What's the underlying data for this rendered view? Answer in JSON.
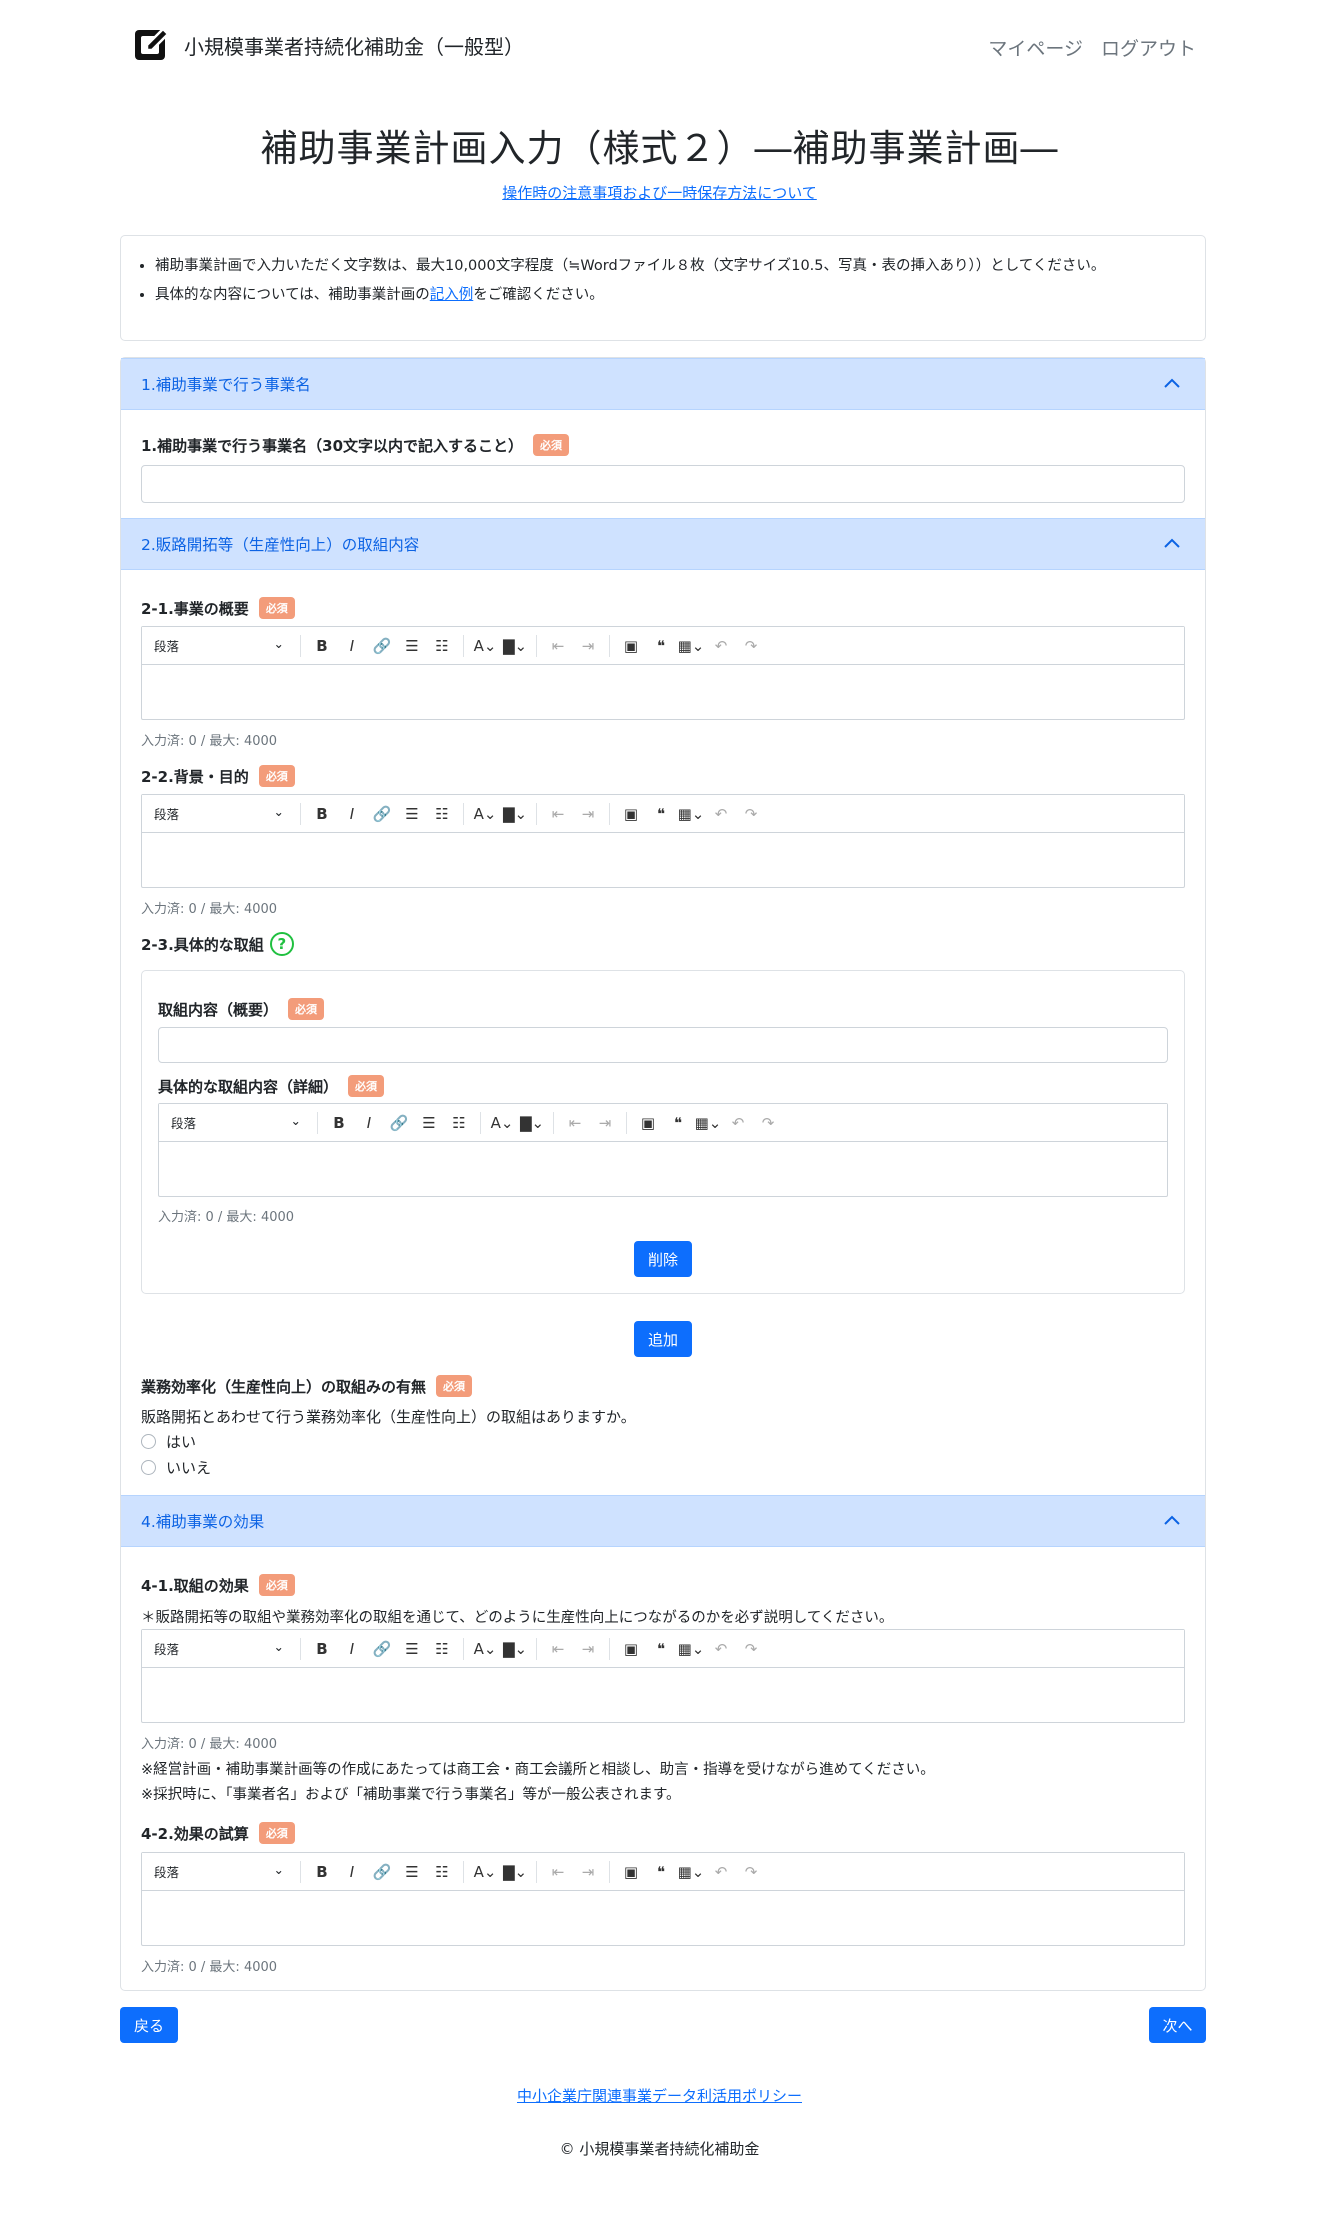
{
  "header": {
    "title": "小規模事業者持続化補助金（一般型）",
    "nav": [
      "マイページ",
      "ログアウト"
    ]
  },
  "page": {
    "title": "補助事業計画入力（様式２）―補助事業計画―",
    "notice_link": "操作時の注意事項および一時保存方法について"
  },
  "info": {
    "item1": "補助事業計画で入力いただく文字数は、最大10,000文字程度（≒Wordファイル８枚（文字サイズ10.5、写真・表の挿入あり））としてください。",
    "item2_pre": "具体的な内容については、補助事業計画の",
    "item2_link": "記入例",
    "item2_post": "をご確認ください。"
  },
  "required": "必須",
  "editor": {
    "paragraph": "段落",
    "count": "入力済: 0 / 最大: 4000"
  },
  "section1": {
    "header": "1.補助事業で行う事業名",
    "label": "1.補助事業で行う事業名（30文字以内で記入すること）"
  },
  "section2": {
    "header": "2.販路開拓等（生産性向上）の取組内容",
    "f21": "2-1.事業の概要",
    "f22": "2-2.背景・目的",
    "f23": "2-3.具体的な取組",
    "sub_overview": "取組内容（概要）",
    "sub_detail": "具体的な取組内容（詳細）",
    "delete": "削除",
    "add": "追加",
    "efficiency_label": "業務効率化（生産性向上）の取組みの有無",
    "efficiency_q": "販路開拓とあわせて行う業務効率化（生産性向上）の取組はありますか。",
    "yes": "はい",
    "no": "いいえ"
  },
  "section4": {
    "header": "4.補助事業の効果",
    "f41": "4-1.取組の効果",
    "f41_note": "＊販路開拓等の取組や業務効率化の取組を通じて、どのように生産性向上につながるのかを必ず説明してください。",
    "note1": "※経営計画・補助事業計画等の作成にあたっては商工会・商工会議所と相談し、助言・指導を受けながら進めてください。",
    "note2": "※採択時に、「事業者名」および「補助事業で行う事業名」等が一般公表されます。",
    "f42": "4-2.効果の試算"
  },
  "nav": {
    "back": "戻る",
    "next": "次へ"
  },
  "footer": {
    "policy": "中小企業庁関連事業データ利活用ポリシー",
    "copyright": "© 小規模事業者持続化補助金"
  }
}
